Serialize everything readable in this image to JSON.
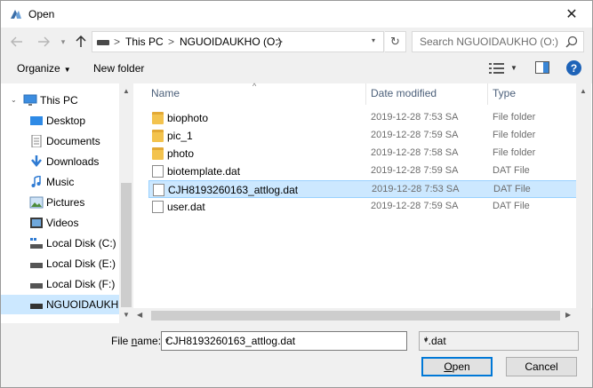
{
  "window": {
    "title": "Open",
    "close_glyph": "✕"
  },
  "address": {
    "crumbs": [
      "This PC",
      "NGUOIDAUKHO (O:)"
    ],
    "separator": ">",
    "search_placeholder": "Search NGUOIDAUKHO (O:)"
  },
  "toolbar": {
    "organize_label": "Organize",
    "new_folder_label": "New folder"
  },
  "nav": {
    "items": [
      {
        "label": "This PC",
        "icon": "computer-icon"
      },
      {
        "label": "Desktop",
        "icon": "desktop-icon"
      },
      {
        "label": "Documents",
        "icon": "documents-icon"
      },
      {
        "label": "Downloads",
        "icon": "downloads-icon"
      },
      {
        "label": "Music",
        "icon": "music-icon"
      },
      {
        "label": "Pictures",
        "icon": "pictures-icon"
      },
      {
        "label": "Videos",
        "icon": "videos-icon"
      },
      {
        "label": "Local Disk (C:)",
        "icon": "drive-icon"
      },
      {
        "label": "Local Disk (E:)",
        "icon": "drive-icon"
      },
      {
        "label": "Local Disk (F:)",
        "icon": "drive-icon"
      },
      {
        "label": "NGUOIDAUKHO",
        "icon": "drive-icon",
        "selected": true
      }
    ]
  },
  "columns": {
    "name": "Name",
    "date": "Date modified",
    "type": "Type"
  },
  "files": [
    {
      "name": "biophoto",
      "date": "2019-12-28 7:53 SA",
      "type": "File folder",
      "icon": "folder-icon"
    },
    {
      "name": "pic_1",
      "date": "2019-12-28 7:59 SA",
      "type": "File folder",
      "icon": "folder-icon"
    },
    {
      "name": "photo",
      "date": "2019-12-28 7:58 SA",
      "type": "File folder",
      "icon": "folder-icon"
    },
    {
      "name": "biotemplate.dat",
      "date": "2019-12-28 7:59 SA",
      "type": "DAT File",
      "icon": "file-icon"
    },
    {
      "name": "CJH8193260163_attlog.dat",
      "date": "2019-12-28 7:53 SA",
      "type": "DAT File",
      "icon": "file-icon",
      "selected": true
    },
    {
      "name": "user.dat",
      "date": "2019-12-28 7:59 SA",
      "type": "DAT File",
      "icon": "file-icon"
    }
  ],
  "bottom": {
    "file_name_label_prefix": "File ",
    "file_name_label_underlined": "n",
    "file_name_label_suffix": "ame:",
    "file_name_value": "CJH8193260163_attlog.dat",
    "filter_value": "*.dat",
    "open_label_underlined": "O",
    "open_label_rest": "pen",
    "cancel_label": "Cancel"
  },
  "colors": {
    "accent": "#0078d7",
    "selection": "#cce8ff",
    "folder": "#f3c34e",
    "help": "#1e63b8"
  }
}
